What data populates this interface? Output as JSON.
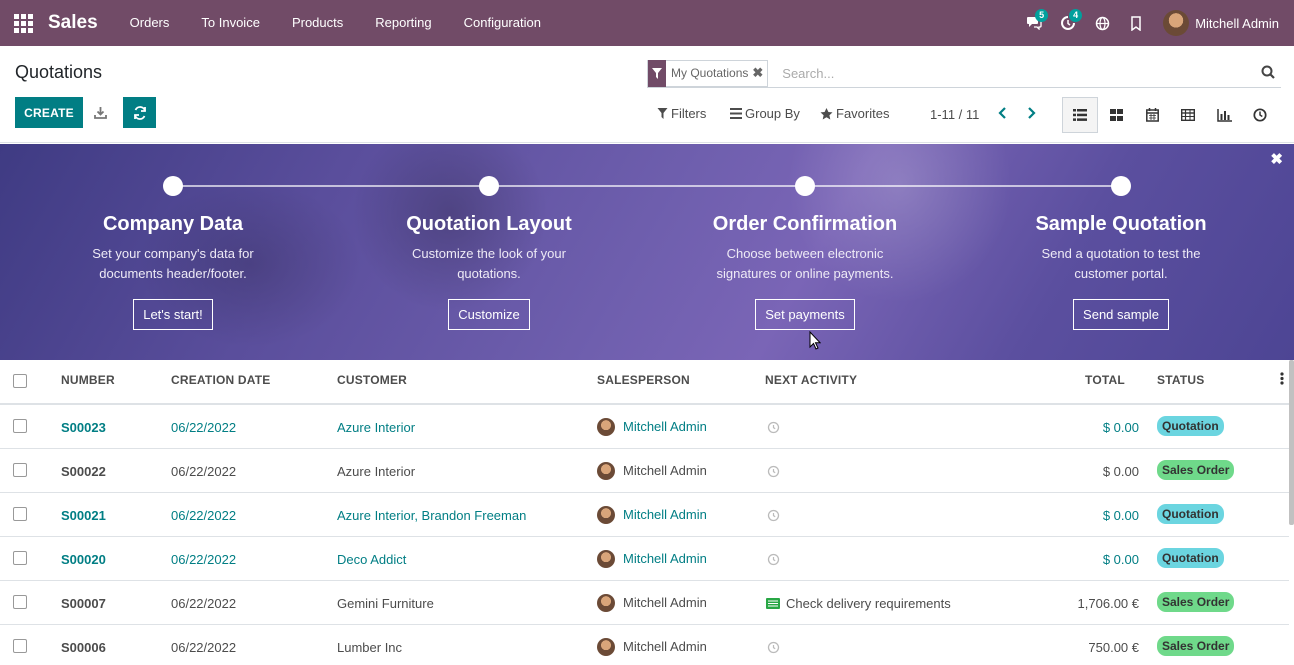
{
  "app": {
    "brand": "Sales",
    "menu": [
      "Orders",
      "To Invoice",
      "Products",
      "Reporting",
      "Configuration"
    ],
    "messages_count": "5",
    "activities_count": "4",
    "user_name": "Mitchell Admin",
    "accent_color": "#714b67",
    "primary_color": "#017e84"
  },
  "control_panel": {
    "title": "Quotations",
    "create_label": "CREATE",
    "facet_label": "My Quotations",
    "search_placeholder": "Search...",
    "filters_label": "Filters",
    "group_by_label": "Group By",
    "favorites_label": "Favorites",
    "pager": "1-11 / 11",
    "views": [
      "list-view-icon",
      "kanban-view-icon",
      "calendar-view-icon",
      "pivot-view-icon",
      "graph-view-icon",
      "activity-view-icon"
    ]
  },
  "onboarding": {
    "steps": [
      {
        "title": "Company Data",
        "desc": "Set your company's data for documents header/footer.",
        "button": "Let's start!"
      },
      {
        "title": "Quotation Layout",
        "desc": "Customize the look of your quotations.",
        "button": "Customize"
      },
      {
        "title": "Order Confirmation",
        "desc": "Choose between electronic signatures or online payments.",
        "button": "Set payments"
      },
      {
        "title": "Sample Quotation",
        "desc": "Send a quotation to test the customer portal.",
        "button": "Send sample"
      }
    ]
  },
  "table": {
    "columns": [
      "NUMBER",
      "CREATION DATE",
      "CUSTOMER",
      "SALESPERSON",
      "NEXT ACTIVITY",
      "TOTAL",
      "STATUS"
    ],
    "rows": [
      {
        "number": "S00023",
        "date": "06/22/2022",
        "customer": "Azure Interior",
        "salesperson": "Mitchell Admin",
        "activity": "",
        "total": "$ 0.00",
        "status": "Quotation",
        "highlight": true
      },
      {
        "number": "S00022",
        "date": "06/22/2022",
        "customer": "Azure Interior",
        "salesperson": "Mitchell Admin",
        "activity": "",
        "total": "$ 0.00",
        "status": "Sales Order",
        "highlight": false
      },
      {
        "number": "S00021",
        "date": "06/22/2022",
        "customer": "Azure Interior, Brandon Freeman",
        "salesperson": "Mitchell Admin",
        "activity": "",
        "total": "$ 0.00",
        "status": "Quotation",
        "highlight": true
      },
      {
        "number": "S00020",
        "date": "06/22/2022",
        "customer": "Deco Addict",
        "salesperson": "Mitchell Admin",
        "activity": "",
        "total": "$ 0.00",
        "status": "Quotation",
        "highlight": true
      },
      {
        "number": "S00007",
        "date": "06/22/2022",
        "customer": "Gemini Furniture",
        "salesperson": "Mitchell Admin",
        "activity": "Check delivery requirements",
        "total": "1,706.00 €",
        "status": "Sales Order",
        "highlight": false
      },
      {
        "number": "S00006",
        "date": "06/22/2022",
        "customer": "Lumber Inc",
        "salesperson": "Mitchell Admin",
        "activity": "",
        "total": "750.00 €",
        "status": "Sales Order",
        "highlight": false
      }
    ]
  }
}
